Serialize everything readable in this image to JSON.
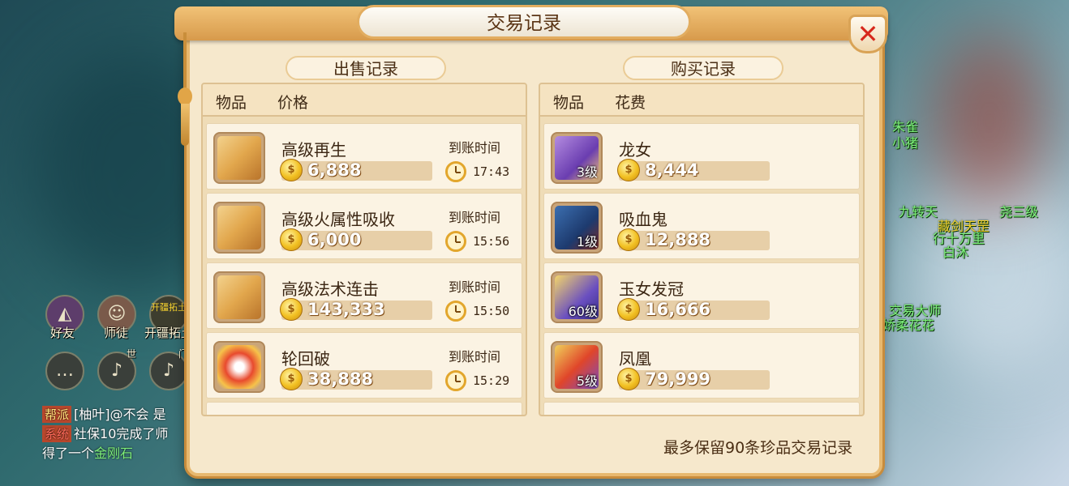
{
  "dialog": {
    "title": "交易记录",
    "close_icon": "close-icon",
    "sell_section": "出售记录",
    "buy_section": "购买记录",
    "sell_headers": {
      "item": "物品",
      "price": "价格"
    },
    "buy_headers": {
      "item": "物品",
      "cost": "花费"
    },
    "footer_note": "最多保留90条珍品交易记录",
    "arrival_label": "到账时间"
  },
  "sell_records": [
    {
      "name": "高级再生",
      "price": "6,888",
      "time": "17:43",
      "icon": "scroll-icon"
    },
    {
      "name": "高级火属性吸收",
      "price": "6,000",
      "time": "15:56",
      "icon": "scroll-icon"
    },
    {
      "name": "高级法术连击",
      "price": "143,333",
      "time": "15:50",
      "icon": "scroll-icon"
    },
    {
      "name": "轮回破",
      "price": "38,888",
      "time": "15:29",
      "icon": "skull-icon"
    }
  ],
  "buy_records": [
    {
      "name": "龙女",
      "price": "8,444",
      "level": "3级",
      "icon": "dragon-girl-icon"
    },
    {
      "name": "吸血鬼",
      "price": "12,888",
      "level": "1级",
      "icon": "vampire-icon"
    },
    {
      "name": "玉女发冠",
      "price": "16,666",
      "level": "60级",
      "icon": "crown-icon"
    },
    {
      "name": "凤凰",
      "price": "79,999",
      "level": "5级",
      "icon": "phoenix-icon"
    }
  ],
  "hud": {
    "friends": "好友",
    "mentor": "师徒",
    "expand": "开疆拓土",
    "expand_badge": "开疆拓土",
    "voice_world": "世",
    "voice_sect": "门"
  },
  "chat": [
    {
      "tag": "帮派",
      "tag_color": "#c0392b",
      "text": "[柚叶]@不会 是"
    },
    {
      "tag": "系统",
      "tag_color": "#c0392b",
      "text": "社保10完成了师"
    },
    {
      "tag": "",
      "tag_color": "",
      "text": "得了一个",
      "highlight": "金刚石"
    }
  ],
  "scene_labels": [
    "朱雀",
    "小猪",
    "九转天",
    "尧三级",
    "藏剑天罡",
    "行十万里",
    "白沐",
    "交易大师",
    "娇柔花花"
  ],
  "colors": {
    "panel": "#f6e8cc",
    "border": "#e7b86f",
    "close": "#d7281c",
    "coin": "#f2c022"
  }
}
